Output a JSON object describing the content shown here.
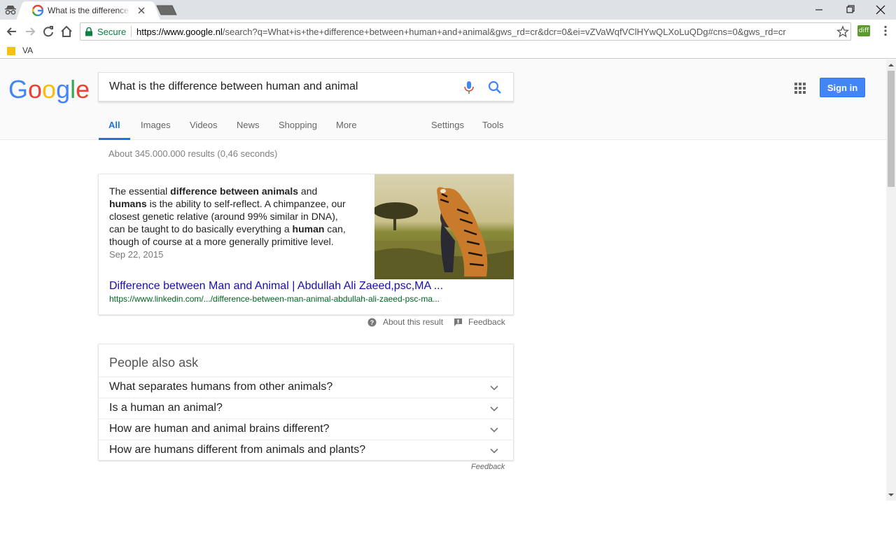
{
  "browser": {
    "tab_title": "What is the difference between human and animal - Google Search",
    "secure_label": "Secure",
    "url_host": "https://www.google.nl",
    "url_rest": "/search?q=What+is+the+difference+between+human+and+animal&gws_rd=cr&dcr=0&ei=vZVaWqfVClHYwQLXoLuQDg#cns=0&gws_rd=cr",
    "extension_label": "diff",
    "bookmark_label": "VA",
    "icons": [
      "incognito-icon",
      "google-favicon",
      "close-icon",
      "back-icon",
      "forward-icon",
      "reload-icon",
      "home-icon",
      "lock-icon",
      "star-icon",
      "menu-icon",
      "minimize-icon",
      "maximize-icon",
      "folder-icon"
    ]
  },
  "search": {
    "query": "What is the difference between human and animal",
    "signin_label": "Sign in",
    "tabs": [
      "All",
      "Images",
      "Videos",
      "News",
      "Shopping",
      "More",
      "Settings",
      "Tools"
    ],
    "result_stats": "About 345.000.000 results (0,46 seconds)"
  },
  "snippet": {
    "t1": "The essential ",
    "b1": "difference between animals",
    "t2": " and ",
    "b2": "humans",
    "t3": " is the ability to self-reflect. A chimpanzee, our closest genetic relative (around 99% similar in DNA), can be taught to do basically everything a ",
    "b3": "human",
    "t4": " can, though of course at a more generally primitive level.",
    "date": "Sep 22, 2015",
    "link_title": "Difference between Man and Animal | Abdullah Ali Zaeed,psc,MA ...",
    "cite": "https://www.linkedin.com/.../difference-between-man-animal-abdullah-ali-zaeed-psc-ma...",
    "about_label": "About this result",
    "feedback_label": "Feedback"
  },
  "people_also_ask": {
    "title": "People also ask",
    "questions": [
      "What separates humans from other animals?",
      "Is a human an animal?",
      "How are human and animal brains different?",
      "How are humans different from animals and plants?"
    ],
    "feedback_label": "Feedback"
  },
  "colors": {
    "accent": "#1a73e8",
    "link": "#1a0dab",
    "cite": "#006621",
    "secure": "#0b8043",
    "signin": "#4285f4"
  }
}
